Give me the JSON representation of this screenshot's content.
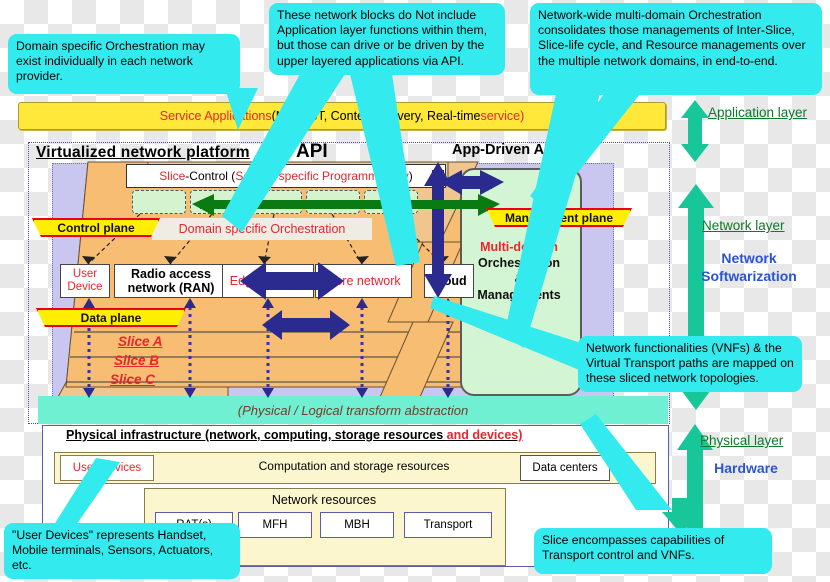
{
  "callouts": {
    "domain_orchestration": "Domain specific Orchestration may exist individually in each network provider.",
    "network_blocks": "These network blocks do Not include Application layer functions within them, but those can drive or be driven by the upper layered applications via API.",
    "multi_domain": "Network-wide multi-domain Orchestration consolidates those managements of Inter-Slice,  Slice-life cycle, and Resource managements over the multiple network domains, in end-to-end.",
    "vnf_mapping": "Network functionalities (VNFs) & the Virtual Transport paths are mapped on these sliced network topologies.",
    "user_devices": "\"User Devices\" represents  Handset, Mobile terminals, Sensors, Actuators, etc.",
    "slice_caps": "Slice encompasses capabilities of Transport control and VNFs."
  },
  "app_bar": {
    "red_1": "Service Applications",
    "black": "  (M2M/IoT, Content delivery, Real-time ",
    "red_2": "service)"
  },
  "platform": {
    "title": "Virtualized network platform",
    "api_label": "API",
    "app_driven_api": "App-Driven API",
    "slice_control_red_1": "Slice",
    "slice_control_black": "-Control (",
    "slice_control_red_2": "Service specific Programmability",
    "slice_control_tail": ")",
    "domain_specific_orchestration": "Domain specific  Orchestration",
    "control_plane": "Control plane",
    "data_plane": "Data  plane",
    "management_plane": "Management plane",
    "slices": [
      "Slice A",
      "Slice B",
      "Slice C"
    ],
    "network_blocks": [
      {
        "label": "User\nDevice",
        "red": true
      },
      {
        "label": "Radio access\nnetwork (RAN)",
        "red": false
      },
      {
        "label": "Edge network",
        "red": true
      },
      {
        "label": "Core network",
        "red": true
      },
      {
        "label": "Cloud",
        "red": false
      }
    ],
    "mgmt_pane": {
      "line1": "Multi-domain",
      "line2": "Orchestration",
      "line3": "&",
      "line4": "Managements"
    }
  },
  "physical": {
    "transform_abstraction": "(Physical / Logical transform abstraction",
    "infra_title_black": "Physical infrastructure (network, computing, storage resources ",
    "infra_title_red": "and devices)",
    "user_devices_box": "User Devices",
    "computation_label": "Computation and storage resources",
    "data_centers_box": "Data centers",
    "network_resources_label": "Network resources",
    "resource_boxes": [
      "RAT(s)",
      "MFH",
      "MBH",
      "Transport"
    ]
  },
  "layers": {
    "application_layer": "Application layer",
    "network_layer": "Network layer",
    "network_softwarization_1": "Network",
    "network_softwarization_2": "Softwarization",
    "physical_layer": "Physical layer",
    "hardware": "Hardware"
  },
  "colors": {
    "callout_bg": "#33eaee",
    "app_bar_bg": "#ffe83a",
    "red_text": "#e8262b",
    "green_arrow": "#17c79a",
    "layer_label": "#0b7a2a",
    "blue_label": "#2a54d8",
    "slice_orange": "#f7bd72",
    "purple_slab": "#c9c6ef",
    "mgmt_pane": "#d4f5d4",
    "navy_arrow": "#2b2b8f"
  }
}
